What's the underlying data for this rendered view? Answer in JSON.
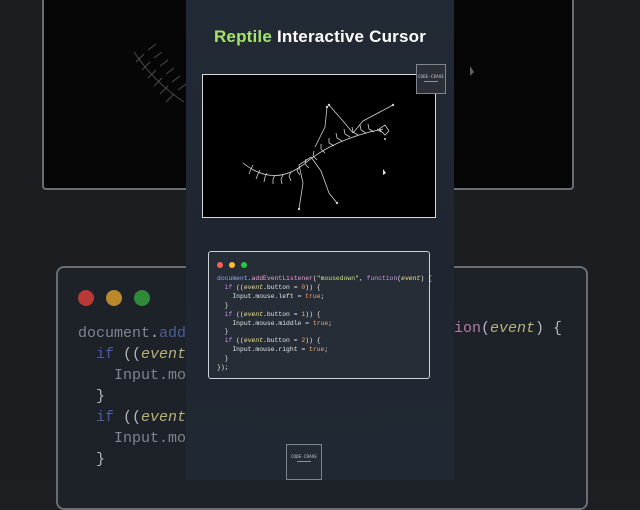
{
  "title": {
    "accent": "Reptile",
    "rest": " Interactive Cursor"
  },
  "watermark": "CODE-CRAVE",
  "code": {
    "window_dots": [
      "#ff5f56",
      "#ffbd2e",
      "#27c93f"
    ],
    "line1": {
      "obj": "document",
      "dot": ".",
      "fn": "addEventListener",
      "p1": "(",
      "str": "\"mousedown\"",
      "sep": ", ",
      "kw": "function",
      "p2": "(",
      "arg": "event",
      "p3": ") {"
    },
    "blocks": [
      {
        "kw": "if",
        "open": " ((",
        "var": "event",
        "prop": ".button = ",
        "num": "0",
        "close": ")) {",
        "body": "Input.mouse.left = ",
        "val": "true",
        "end": ";"
      },
      {
        "kw": "if",
        "open": " ((",
        "var": "event",
        "prop": ".button = ",
        "num": "1",
        "close": ")) {",
        "body": "Input.mouse.middle = ",
        "val": "true",
        "end": ";"
      },
      {
        "kw": "if",
        "open": " ((",
        "var": "event",
        "prop": ".button = ",
        "num": "2",
        "close": ")) {",
        "body": "Input.mouse.right = ",
        "val": "true",
        "end": ";"
      }
    ],
    "brace": "}",
    "closing": "});"
  }
}
